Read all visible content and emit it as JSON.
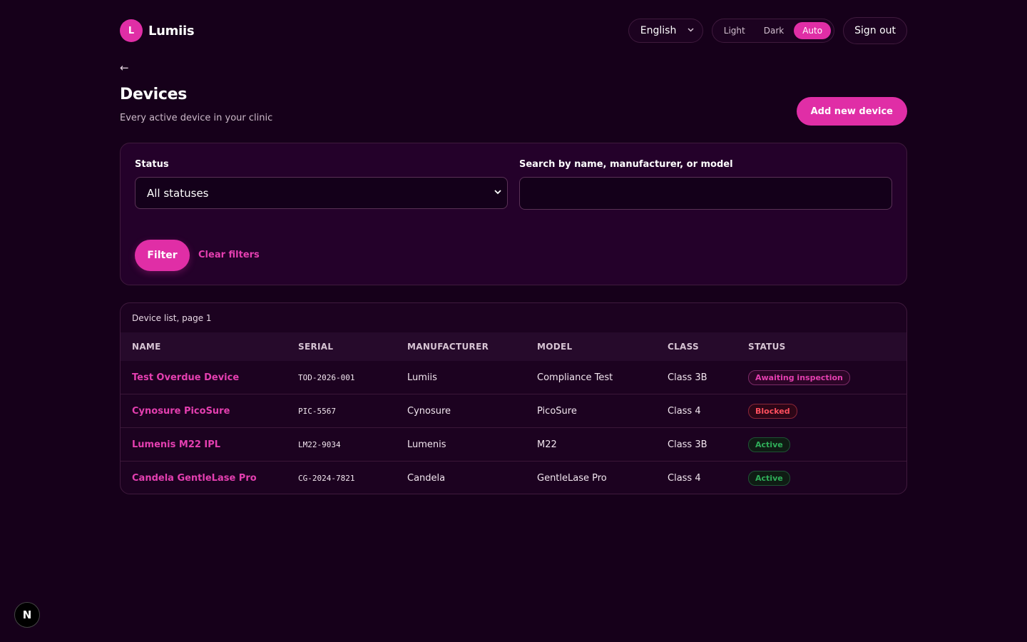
{
  "app": {
    "logo_letter": "L",
    "name": "Lumiis"
  },
  "header": {
    "language": "English",
    "theme_options": [
      "Light",
      "Dark",
      "Auto"
    ],
    "theme_selected": "Auto",
    "sign_out": "Sign out"
  },
  "page": {
    "back": "←",
    "title": "Devices",
    "subtitle": "Every active device in your clinic",
    "add_button": "Add new device"
  },
  "filters": {
    "status_label": "Status",
    "status_value": "All statuses",
    "search_label": "Search by name, manufacturer, or model",
    "search_value": "",
    "filter_button": "Filter",
    "clear_link": "Clear filters"
  },
  "table": {
    "caption": "Device list, page 1",
    "headers": [
      "NAME",
      "SERIAL",
      "MANUFACTURER",
      "MODEL",
      "CLASS",
      "STATUS"
    ],
    "rows": [
      {
        "name": "Test Overdue Device",
        "serial": "TOD-2026-001",
        "manufacturer": "Lumiis",
        "model": "Compliance Test",
        "class": "Class 3B",
        "status": "Awaiting inspection",
        "status_kind": "await"
      },
      {
        "name": "Cynosure PicoSure",
        "serial": "PIC-5567",
        "manufacturer": "Cynosure",
        "model": "PicoSure",
        "class": "Class 4",
        "status": "Blocked",
        "status_kind": "blocked"
      },
      {
        "name": "Lumenis M22 IPL",
        "serial": "LM22-9034",
        "manufacturer": "Lumenis",
        "model": "M22",
        "class": "Class 3B",
        "status": "Active",
        "status_kind": "active"
      },
      {
        "name": "Candela GentleLase Pro",
        "serial": "CG-2024-7821",
        "manufacturer": "Candela",
        "model": "GentleLase Pro",
        "class": "Class 4",
        "status": "Active",
        "status_kind": "active"
      }
    ]
  },
  "dev_badge": "N",
  "colors": {
    "accent": "#e02ea6",
    "background": "#16001a",
    "blocked": "#ff4f5e",
    "active": "#2fae59"
  }
}
